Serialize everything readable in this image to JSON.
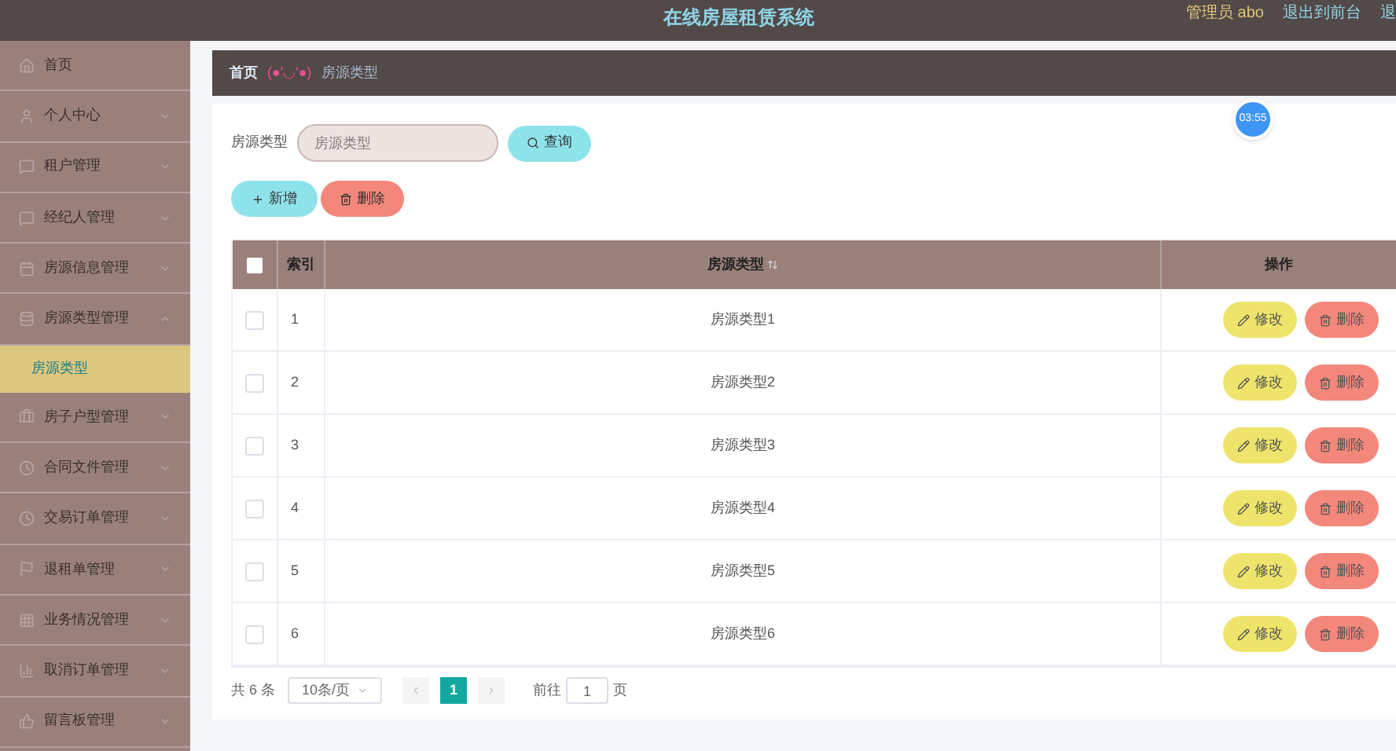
{
  "header": {
    "title": "在线房屋租赁系统",
    "user": "管理员 abo",
    "links": [
      "退出到前台",
      "退"
    ]
  },
  "sidebar": {
    "items": [
      {
        "label": "首页"
      },
      {
        "label": "个人中心",
        "expanded": false
      },
      {
        "label": "租户管理",
        "expanded": false
      },
      {
        "label": "经纪人管理",
        "expanded": false
      },
      {
        "label": "房源信息管理",
        "expanded": false
      },
      {
        "label": "房源类型管理",
        "expanded": true,
        "children": [
          {
            "label": "房源类型",
            "selected": true
          }
        ]
      },
      {
        "label": "房子户型管理",
        "expanded": false
      },
      {
        "label": "合同文件管理",
        "expanded": false
      },
      {
        "label": "交易订单管理",
        "expanded": false
      },
      {
        "label": "退租单管理",
        "expanded": false
      },
      {
        "label": "业务情况管理",
        "expanded": false
      },
      {
        "label": "取消订单管理",
        "expanded": false
      },
      {
        "label": "留言板管理",
        "expanded": false
      }
    ]
  },
  "breadcrumb": {
    "home": "首页",
    "emoticon": "(●'◡'●)",
    "current": "房源类型"
  },
  "timer": "03:55",
  "search": {
    "label": "房源类型",
    "placeholder": "房源类型",
    "button": "查询"
  },
  "actions": {
    "add": "新增",
    "delete": "删除"
  },
  "table": {
    "columns": [
      "索引",
      "房源类型",
      "操作"
    ],
    "all_checked": false,
    "rows": [
      {
        "index": "1",
        "type": "房源类型1",
        "checked": false,
        "edit": "修改",
        "delete": "删除"
      },
      {
        "index": "2",
        "type": "房源类型2",
        "checked": false,
        "edit": "修改",
        "delete": "删除"
      },
      {
        "index": "3",
        "type": "房源类型3",
        "checked": false,
        "edit": "修改",
        "delete": "删除"
      },
      {
        "index": "4",
        "type": "房源类型4",
        "checked": false,
        "edit": "修改",
        "delete": "删除"
      },
      {
        "index": "5",
        "type": "房源类型5",
        "checked": false,
        "edit": "修改",
        "delete": "删除"
      },
      {
        "index": "6",
        "type": "房源类型6",
        "checked": false,
        "edit": "修改",
        "delete": "删除"
      }
    ]
  },
  "pagination": {
    "total": "共 6 条",
    "page_size": "10条/页",
    "pages": [
      {
        "label": "1",
        "selected": true
      }
    ],
    "goto_label": "前往",
    "goto_value": "1",
    "goto_unit": "页"
  }
}
